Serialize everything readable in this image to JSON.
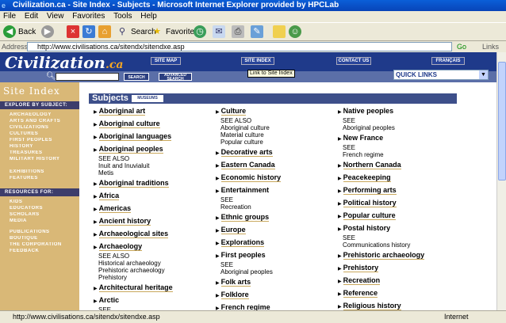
{
  "window": {
    "title": "Civilization.ca - Site Index - Subjects - Microsoft Internet Explorer provided by HPCLab"
  },
  "menu": [
    "File",
    "Edit",
    "View",
    "Favorites",
    "Tools",
    "Help"
  ],
  "toolbar": {
    "back": "Back",
    "search": "Search",
    "favorites": "Favorites"
  },
  "address": {
    "label": "Address",
    "url": "http://www.civilisations.ca/sitendx/sitendxe.asp",
    "go": "Go",
    "links": "Links"
  },
  "site": {
    "logo_main": "Civilization",
    "logo_ca": ".ca",
    "nav": [
      "SITE MAP",
      "SITE INDEX",
      "CONTACT US",
      "FRANÇAIS"
    ],
    "search_btn": "SEARCH",
    "advanced_btn": "ADVANCED SEARCH",
    "quick_links": "QUICK LINKS",
    "tooltip": "Link to Site Index"
  },
  "sidebar": {
    "title": "Site Index",
    "explore_head": "EXPLORE BY SUBJECT:",
    "explore": [
      "ARCHAEOLOGY",
      "ARTS AND CRAFTS",
      "CIVILIZATIONS",
      "CULTURES",
      "FIRST PEOPLES",
      "HISTORY",
      "TREASURES",
      "MILITARY HISTORY"
    ],
    "explore2": [
      "EXHIBITIONS",
      "FEATURES"
    ],
    "resources_head": "RESOURCES FOR:",
    "resources": [
      "KIDS",
      "EDUCATORS",
      "SCHOLARS",
      "MEDIA"
    ],
    "resources2": [
      "PUBLICATIONS",
      "BOUTIQUE",
      "THE CORPORATION",
      "FEEDBACK"
    ]
  },
  "subjects": {
    "title": "Subjects",
    "museums_btn": "MUSEUMS",
    "col1": [
      {
        "label": "Aboriginal art",
        "link": true
      },
      {
        "label": "Aboriginal culture",
        "link": true
      },
      {
        "label": "Aboriginal languages",
        "link": true
      },
      {
        "label": "Aboriginal peoples",
        "link": true,
        "sub": [
          "SEE ALSO",
          "Inuit and Inuvialuit",
          "Metis"
        ]
      },
      {
        "label": "Aboriginal traditions",
        "link": true
      },
      {
        "label": "Africa",
        "link": true
      },
      {
        "label": "Americas",
        "link": true
      },
      {
        "label": "Ancient history",
        "link": true
      },
      {
        "label": "Archaeological sites",
        "link": true
      },
      {
        "label": "Archaeology",
        "link": true,
        "sub": [
          "SEE ALSO",
          "Historical archaeology",
          "Prehistoric archaeology",
          "Prehistory"
        ]
      },
      {
        "label": "Architectural heritage",
        "link": true
      },
      {
        "label": "Arctic",
        "link": false,
        "sub": [
          "SEE"
        ]
      }
    ],
    "col2": [
      {
        "label": "Culture",
        "link": true,
        "sub": [
          "SEE ALSO",
          "Aboriginal culture",
          "Material culture",
          "Popular culture"
        ]
      },
      {
        "label": "Decorative arts",
        "link": true
      },
      {
        "label": "Eastern Canada",
        "link": true
      },
      {
        "label": "Economic history",
        "link": true
      },
      {
        "label": "Entertainment",
        "link": false,
        "sub": [
          "SEE",
          "Recreation"
        ]
      },
      {
        "label": "Ethnic groups",
        "link": true
      },
      {
        "label": "Europe",
        "link": true
      },
      {
        "label": "Explorations",
        "link": true
      },
      {
        "label": "First peoples",
        "link": false,
        "sub": [
          "SEE",
          "Aboriginal peoples"
        ]
      },
      {
        "label": "Folk arts",
        "link": true
      },
      {
        "label": "Folklore",
        "link": true
      },
      {
        "label": "French regime",
        "link": true
      }
    ],
    "col3": [
      {
        "label": "Native peoples",
        "link": false,
        "sub": [
          "SEE",
          "Aboriginal peoples"
        ]
      },
      {
        "label": "New France",
        "link": false,
        "sub": [
          "SEE",
          "French regime"
        ]
      },
      {
        "label": "Northern Canada",
        "link": true
      },
      {
        "label": "Peacekeeping",
        "link": true
      },
      {
        "label": "Performing arts",
        "link": true
      },
      {
        "label": "Political history",
        "link": true
      },
      {
        "label": "Popular culture",
        "link": true
      },
      {
        "label": "Postal history",
        "link": false,
        "sub": [
          "SEE",
          "Communications history"
        ]
      },
      {
        "label": "Prehistoric archaeology",
        "link": true
      },
      {
        "label": "Prehistory",
        "link": true
      },
      {
        "label": "Recreation",
        "link": true
      },
      {
        "label": "Reference",
        "link": true
      },
      {
        "label": "Religious history",
        "link": true
      }
    ]
  },
  "status": {
    "url": "http://www.civilisations.ca/sitendx/sitendxe.asp",
    "zone": "Internet"
  }
}
